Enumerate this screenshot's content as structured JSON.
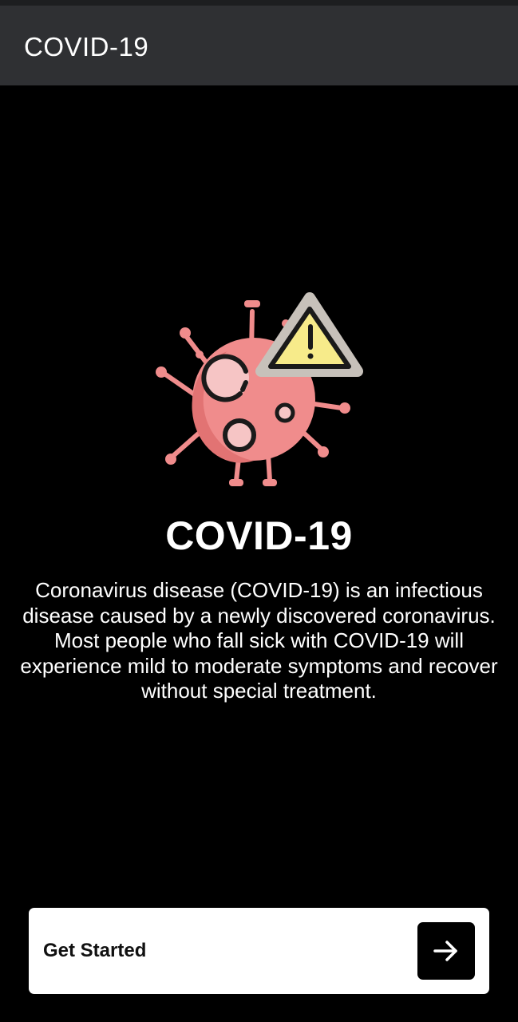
{
  "app_bar": {
    "title": "COVID-19"
  },
  "hero": {
    "illustration_icon": "virus-warning-icon",
    "colors": {
      "virus_body": "#f08c8c",
      "virus_highlight": "#f6c5c5",
      "warning_fill": "#f7eb8a",
      "warning_border": "#c7c1ba",
      "outline": "#1a1a1a"
    }
  },
  "intro": {
    "headline": "COVID-19",
    "description": "Coronavirus disease (COVID-19) is an infectious disease caused by a newly discovered coronavirus. Most people who fall sick with COVID-19 will experience mild to moderate symptoms and recover without special treatment."
  },
  "cta": {
    "label": "Get Started",
    "icon": "arrow-right-icon"
  }
}
